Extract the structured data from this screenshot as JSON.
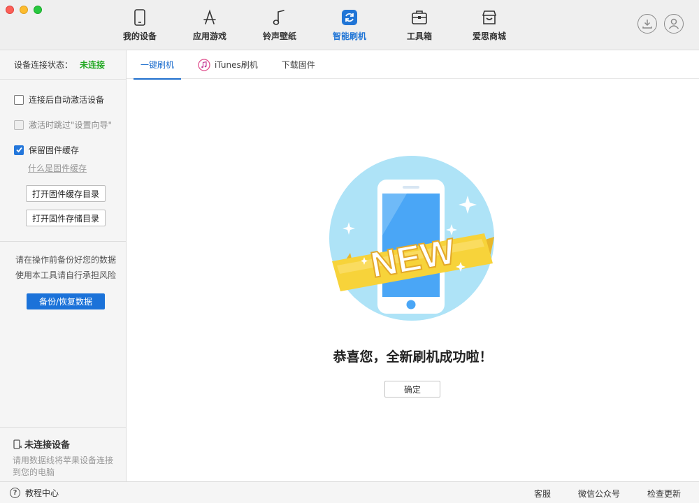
{
  "window": {
    "title": ""
  },
  "topnav": {
    "items": [
      {
        "label": "我的设备",
        "icon": "phone-icon"
      },
      {
        "label": "应用游戏",
        "icon": "app-store-icon"
      },
      {
        "label": "铃声壁纸",
        "icon": "music-note-icon"
      },
      {
        "label": "智能刷机",
        "icon": "refresh-icon",
        "active": true
      },
      {
        "label": "工具箱",
        "icon": "toolbox-icon"
      },
      {
        "label": "爱思商城",
        "icon": "store-icon"
      }
    ],
    "right_icons": [
      "download-icon",
      "user-icon"
    ]
  },
  "sidebar": {
    "conn_label": "设备连接状态：",
    "conn_status": "未连接",
    "options": [
      {
        "label": "连接后自动激活设备",
        "checked": false,
        "disabled": false
      },
      {
        "label": "激活时跳过\"设置向导\"",
        "checked": false,
        "disabled": true
      },
      {
        "label": "保留固件缓存",
        "checked": true,
        "disabled": false
      }
    ],
    "help_link": "什么是固件缓存",
    "btn_open_cache": "打开固件缓存目录",
    "btn_open_store": "打开固件存储目录",
    "warn_line1": "请在操作前备份好您的数据",
    "warn_line2": "使用本工具请自行承担风险",
    "backup_btn": "备份/恢复数据",
    "nodevice_title": "未连接设备",
    "nodevice_desc": "请用数据线将苹果设备连接到您的电脑"
  },
  "tabs": [
    {
      "label": "一键刷机",
      "active": true
    },
    {
      "label": "iTunes刷机",
      "active": false,
      "icon": "itunes-icon"
    },
    {
      "label": "下载固件",
      "active": false
    }
  ],
  "main": {
    "badge_text": "NEW",
    "success_text": "恭喜您，全新刷机成功啦！",
    "ok_label": "确定"
  },
  "footer": {
    "help_label": "教程中心",
    "links": [
      "客服",
      "微信公众号",
      "检查更新"
    ]
  },
  "colors": {
    "accent": "#2075d6",
    "status_disconnected": "#21a821",
    "badge_yellow": "#f7d33a",
    "illus_circle": "#aee3f7"
  }
}
